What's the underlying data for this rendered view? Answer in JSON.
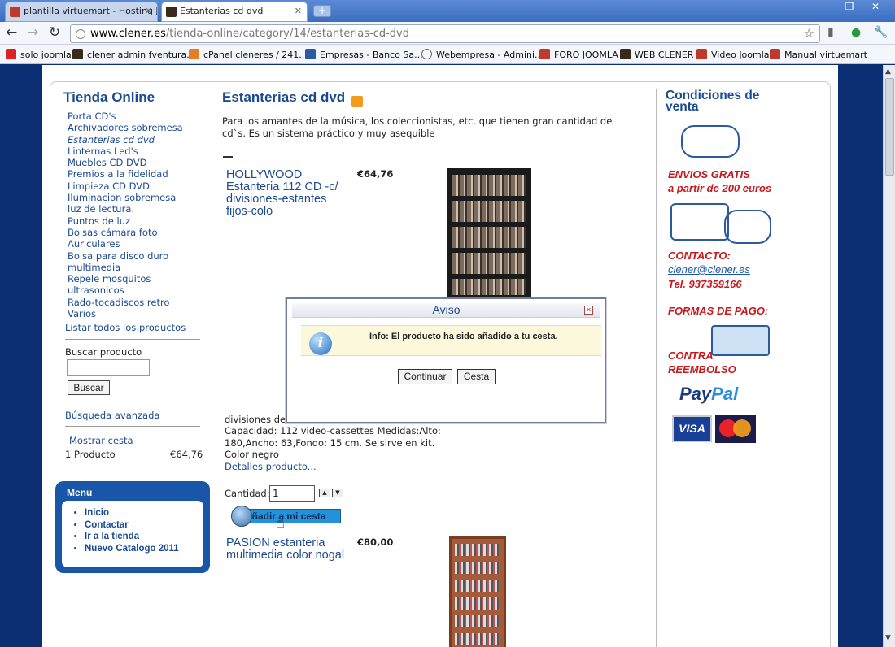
{
  "browser": {
    "tabs": [
      {
        "label": "plantilla virtuemart - Hosting J"
      },
      {
        "label": "Estanterias cd dvd"
      }
    ],
    "url_host": "www.clener.es",
    "url_path": "/tienda-online/category/14/estanterias-cd-dvd",
    "bookmarks": [
      {
        "label": "solo joomla"
      },
      {
        "label": "clener admin fventura..."
      },
      {
        "label": "cPanel cleneres / 241...."
      },
      {
        "label": "Empresas - Banco Sa..."
      },
      {
        "label": "Webempresa - Admini..."
      },
      {
        "label": "FORO JOOMLA"
      },
      {
        "label": "WEB CLENER"
      },
      {
        "label": "Video Joomla"
      },
      {
        "label": "Manual virtuemart"
      }
    ]
  },
  "sidebar": {
    "title": "Tienda Online",
    "categories": [
      "Porta CD's",
      "Archivadores sobremesa",
      "Estanterias cd dvd",
      "Linternas Led's",
      "Muebles CD DVD",
      "Premios a la fidelidad",
      "Limpieza CD DVD",
      "Iluminacion sobremesa",
      "luz de lectura.",
      "Puntos de luz",
      "Bolsas cámara foto",
      "Auriculares",
      "Bolsa para disco duro multimedia",
      "Repele mosquitos ultrasonicos",
      "Rado-tocadiscos retro",
      "Varios"
    ],
    "list_all": "Listar todos los productos",
    "search_label": "Buscar producto",
    "search_button": "Buscar",
    "advanced_search": "Búsqueda avanzada",
    "show_cart": "Mostrar cesta",
    "cart_count": "1 Producto",
    "cart_total": "€64,76",
    "menu_title": "Menu",
    "menu_items": [
      "Inicio",
      "Contactar",
      "Ir a la tienda",
      "Nuevo Catalogo 2011"
    ]
  },
  "main": {
    "title": "Estanterias cd dvd",
    "intro": "Para los amantes de la música, los coleccionistas, etc. que tienen gran cantidad de cd`s. Es un sistema práctico y muy asequible",
    "products": [
      {
        "name": "HOLLYWOOD Estanteria 112 CD -c/ divisiones-estantes fijos-colo",
        "price": "€64,76",
        "desc_line1": "divisiones de",
        "desc_line2": "Capacidad: 112 video-cassettes Medidas:Alto: 180,Ancho: 63,Fondo: 15 cm. Se sirve en kit.",
        "desc_line3": "Color negro",
        "details_link": "Detalles producto...",
        "qty_label": "Cantidad:",
        "qty_value": "1",
        "add_button": "Añadir a mi cesta"
      },
      {
        "name": "PASION estanteria multimedia color nogal",
        "price": "€80,00"
      }
    ]
  },
  "right": {
    "title": "Condiciones de venta",
    "envios_1": "ENVIOS GRATIS",
    "envios_2": "a partir de 200 euros",
    "contacto": "CONTACTO:",
    "email": "clener@clener.es",
    "tel": "Tel. 937359166",
    "formas": "FORMAS DE PAGO:",
    "contra_1": "CONTRA",
    "contra_2": "REEMBOLSO",
    "paypal_a": "Pay",
    "paypal_b": "Pal",
    "visa": "VISA"
  },
  "modal": {
    "title": "Aviso",
    "message": "Info: El producto ha sido añadido a tu cesta.",
    "continue_button": "Continuar",
    "cart_button": "Cesta"
  },
  "colors": {
    "accent": "#1a4a91",
    "page_bg": "#0c2f73",
    "red": "#c8171d"
  }
}
